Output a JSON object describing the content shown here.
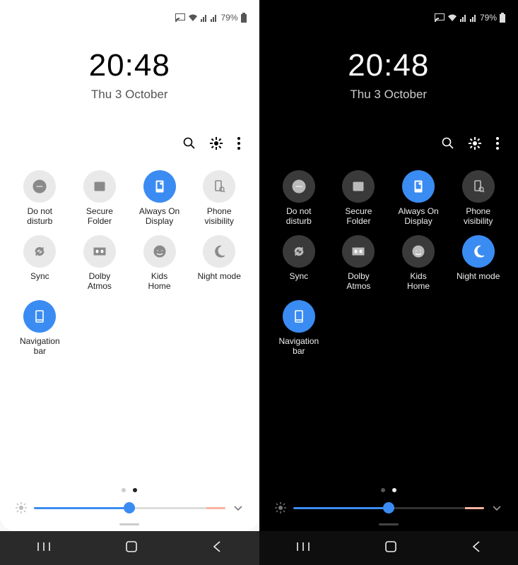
{
  "status": {
    "battery_pct": "79%"
  },
  "clock": {
    "time": "20:48",
    "date": "Thu 3 October"
  },
  "tiles": [
    {
      "key": "dnd",
      "label": "Do not\ndisturb",
      "active_light": false,
      "active_dark": false
    },
    {
      "key": "secure",
      "label": "Secure\nFolder",
      "active_light": false,
      "active_dark": false
    },
    {
      "key": "aod",
      "label": "Always On\nDisplay",
      "active_light": true,
      "active_dark": true
    },
    {
      "key": "phonevis",
      "label": "Phone\nvisibility",
      "active_light": false,
      "active_dark": false
    },
    {
      "key": "sync",
      "label": "Sync",
      "active_light": false,
      "active_dark": false
    },
    {
      "key": "dolby",
      "label": "Dolby\nAtmos",
      "active_light": false,
      "active_dark": false
    },
    {
      "key": "kidshome",
      "label": "Kids\nHome",
      "active_light": false,
      "active_dark": false
    },
    {
      "key": "nightmode",
      "label": "Night mode",
      "active_light": false,
      "active_dark": true
    },
    {
      "key": "navbar",
      "label": "Navigation\nbar",
      "active_light": true,
      "active_dark": true
    }
  ],
  "brightness": {
    "percent": 50
  },
  "pager": {
    "pages": 2,
    "active": 1
  }
}
